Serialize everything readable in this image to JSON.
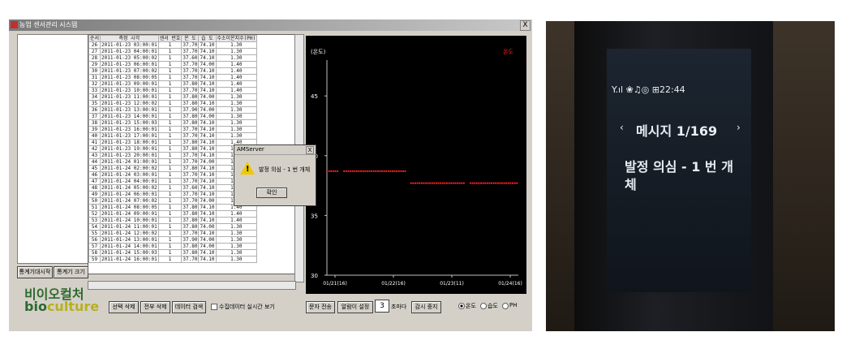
{
  "window": {
    "title": "농업 센서관리 시스템",
    "close_label": "X"
  },
  "left_panel": {
    "btn_pause": "통계기대시작",
    "btn_clear": "통계기 크기",
    "logo_ko": "비이오컬처",
    "logo_en_a": "bio",
    "logo_en_b": "culture"
  },
  "table": {
    "columns": [
      "순서",
      "측정 시각",
      "센서 번호",
      "온 도",
      "습 도",
      "수소이온지수(PH)"
    ],
    "rows": [
      [
        "26",
        "2011-01-23 03:00:01",
        "1",
        "37.70",
        "74.10",
        "1.30"
      ],
      [
        "27",
        "2011-01-23 04:00:01",
        "1",
        "37.70",
        "74.10",
        "1.30"
      ],
      [
        "28",
        "2011-01-23 05:00:02",
        "1",
        "37.60",
        "74.10",
        "1.30"
      ],
      [
        "29",
        "2011-01-23 06:00:01",
        "1",
        "37.70",
        "74.00",
        "1.40"
      ],
      [
        "30",
        "2011-01-23 07:00:02",
        "1",
        "37.70",
        "74.10",
        "1.40"
      ],
      [
        "31",
        "2011-01-23 08:00:05",
        "1",
        "37.70",
        "74.10",
        "1.40"
      ],
      [
        "32",
        "2011-01-23 09:00:01",
        "1",
        "37.80",
        "74.10",
        "1.40"
      ],
      [
        "33",
        "2011-01-23 10:00:01",
        "1",
        "37.70",
        "74.10",
        "1.40"
      ],
      [
        "34",
        "2011-01-23 11:00:01",
        "1",
        "37.80",
        "74.00",
        "1.30"
      ],
      [
        "35",
        "2011-01-23 12:00:02",
        "1",
        "37.80",
        "74.10",
        "1.30"
      ],
      [
        "36",
        "2011-01-23 13:00:01",
        "1",
        "37.90",
        "74.00",
        "1.30"
      ],
      [
        "37",
        "2011-01-23 14:00:01",
        "1",
        "37.80",
        "74.00",
        "1.30"
      ],
      [
        "38",
        "2011-01-23 15:00:03",
        "1",
        "37.80",
        "74.10",
        "1.30"
      ],
      [
        "39",
        "2011-01-23 16:00:01",
        "1",
        "37.70",
        "74.10",
        "1.30"
      ],
      [
        "40",
        "2011-01-23 17:00:01",
        "1",
        "37.70",
        "74.10",
        "1.30"
      ],
      [
        "41",
        "2011-01-23 18:00:01",
        "1",
        "37.80",
        "74.10",
        "1.40"
      ],
      [
        "42",
        "2011-01-23 19:00:01",
        "1",
        "37.80",
        "74.10",
        "1.40"
      ],
      [
        "43",
        "2011-01-23 20:00:01",
        "1",
        "37.70",
        "74.10",
        "1.40"
      ],
      [
        "44",
        "2011-01-24 01:00:01",
        "1",
        "37.70",
        "74.00",
        "1.40"
      ],
      [
        "45",
        "2011-01-24 02:00:02",
        "1",
        "37.80",
        "74.10",
        "1.40"
      ],
      [
        "46",
        "2011-01-24 03:00:01",
        "1",
        "37.70",
        "74.10",
        "1.40"
      ],
      [
        "47",
        "2011-01-24 04:00:01",
        "1",
        "37.70",
        "74.10",
        "1.40"
      ],
      [
        "48",
        "2011-01-24 05:00:02",
        "1",
        "37.60",
        "74.10",
        "1.30"
      ],
      [
        "49",
        "2011-01-24 06:00:01",
        "1",
        "37.70",
        "74.10",
        "1.30"
      ],
      [
        "50",
        "2011-01-24 07:00:02",
        "1",
        "37.70",
        "74.00",
        "1.40"
      ],
      [
        "51",
        "2011-01-24 08:00:05",
        "1",
        "37.80",
        "74.10",
        "1.40"
      ],
      [
        "52",
        "2011-01-24 09:00:01",
        "1",
        "37.80",
        "74.10",
        "1.40"
      ],
      [
        "53",
        "2011-01-24 10:00:01",
        "1",
        "37.80",
        "74.10",
        "1.40"
      ],
      [
        "54",
        "2011-01-24 11:00:01",
        "1",
        "37.80",
        "74.00",
        "1.30"
      ],
      [
        "55",
        "2011-01-24 12:00:02",
        "1",
        "37.70",
        "74.10",
        "1.30"
      ],
      [
        "56",
        "2011-01-24 13:00:01",
        "1",
        "37.90",
        "74.00",
        "1.30"
      ],
      [
        "57",
        "2011-01-24 14:00:01",
        "1",
        "37.80",
        "74.00",
        "1.30"
      ],
      [
        "58",
        "2011-01-24 15:00:03",
        "1",
        "37.80",
        "74.10",
        "1.30"
      ],
      [
        "59",
        "2011-01-24 16:00:01",
        "1",
        "37.70",
        "74.10",
        "1.30"
      ]
    ]
  },
  "dialog": {
    "title": "AMServer",
    "message": "발정 의심 - 1 번 개체",
    "ok_label": "확인",
    "close_label": "X"
  },
  "bottom_bar": {
    "btn_delete_selected": "선택 삭제",
    "btn_delete_all": "전부 삭제",
    "btn_data_search": "데이터 검색",
    "realtime_label": "수집데이터 실시간 보기",
    "btn_sms": "문자 전송",
    "btn_alarm": "알람이 설정",
    "interval_value": "3",
    "interval_unit": "초마다",
    "btn_stop": "감시 중지",
    "radio_temp": "온도",
    "radio_humid": "습도",
    "radio_ph": "PH",
    "selected_radio": "온도"
  },
  "chart_data": {
    "type": "scatter",
    "title": "",
    "ylabel": "(온도)",
    "legend": [
      "온도"
    ],
    "yticks": [
      30,
      35,
      40,
      45
    ],
    "ylim": [
      30,
      48
    ],
    "xticks": [
      "01/21(16)",
      "01/22(16)",
      "01/23(11)",
      "01/24(16)"
    ],
    "series": [
      {
        "name": "온도",
        "color": "#ff2020",
        "segments": [
          {
            "x_start": 0.0,
            "x_end": 0.06,
            "y": 38.7
          },
          {
            "x_start": 0.09,
            "x_end": 0.41,
            "y": 38.7
          },
          {
            "x_start": 0.44,
            "x_end": 0.72,
            "y": 37.7
          },
          {
            "x_start": 0.75,
            "x_end": 1.0,
            "y": 37.7
          }
        ]
      }
    ]
  },
  "phone": {
    "status": "Y.ıl ❀♫◎ ⊞22:44",
    "nav": "메시지 1/169",
    "message_line1": "발정 의심 - 1 번 개",
    "message_line2": "체"
  }
}
